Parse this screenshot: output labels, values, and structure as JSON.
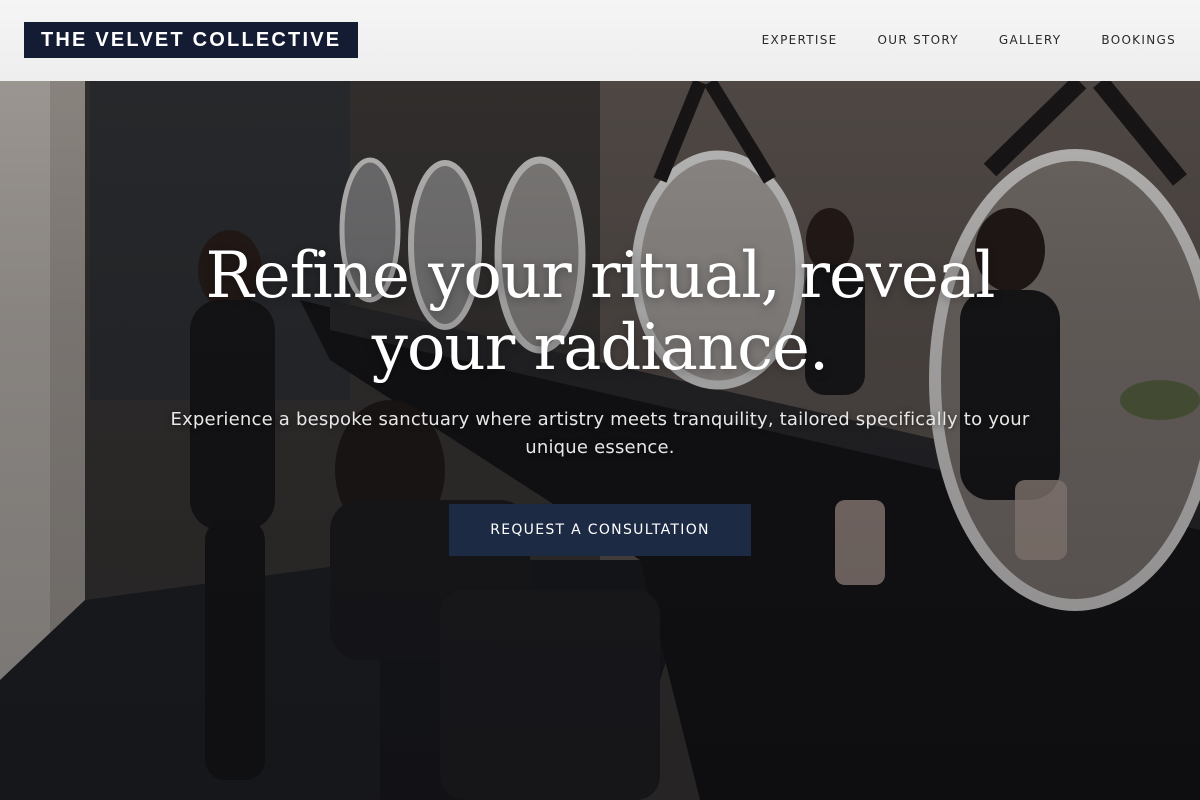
{
  "brand": {
    "name": "THE VELVET COLLECTIVE",
    "color": "#141c33"
  },
  "nav": {
    "items": [
      {
        "label": "EXPERTISE"
      },
      {
        "label": "OUR STORY"
      },
      {
        "label": "GALLERY"
      },
      {
        "label": "BOOKINGS"
      }
    ]
  },
  "hero": {
    "title": "Refine your ritual, reveal your radiance.",
    "subtitle": "Experience a bespoke sanctuary where artistry meets tranquility, tailored specifically to your unique essence.",
    "cta_label": "REQUEST A CONSULTATION",
    "cta_color": "#1d2a44",
    "background": "salon-interior-photo"
  }
}
